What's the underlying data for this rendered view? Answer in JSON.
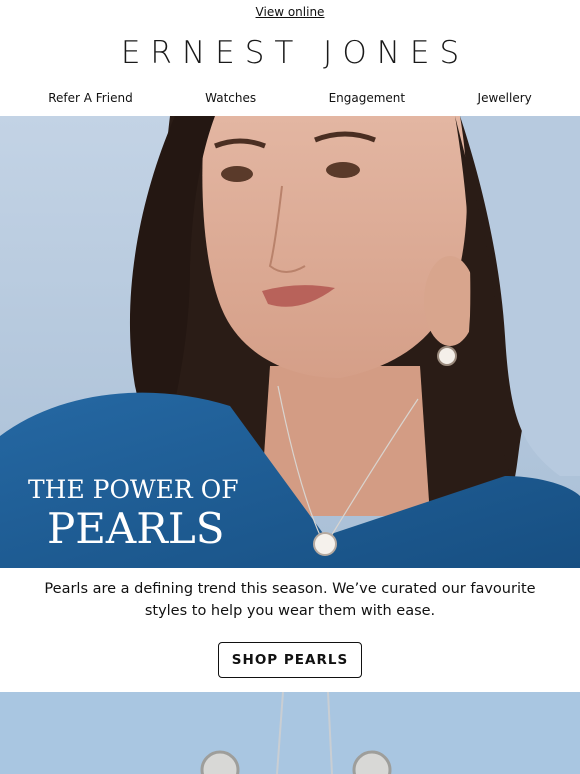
{
  "header": {
    "view_online": "View online",
    "brand": "ERNEST JONES"
  },
  "nav": {
    "items": [
      "Refer A Friend",
      "Watches",
      "Engagement",
      "Jewellery"
    ]
  },
  "hero": {
    "title_line1": "THE POWER OF",
    "title_line2": "PEARLS"
  },
  "body": {
    "description": "Pearls are a defining trend this season. We’ve curated our favourite styles to help you wear them with ease.",
    "cta": "SHOP PEARLS"
  },
  "colors": {
    "background": "#ffffff",
    "hero_sky": "#b9cbdf",
    "sweater_blue": "#1f5f96",
    "hair": "#2a1c16",
    "skin": "#d9a78f",
    "bottom_bg": "#a9c6e1"
  }
}
